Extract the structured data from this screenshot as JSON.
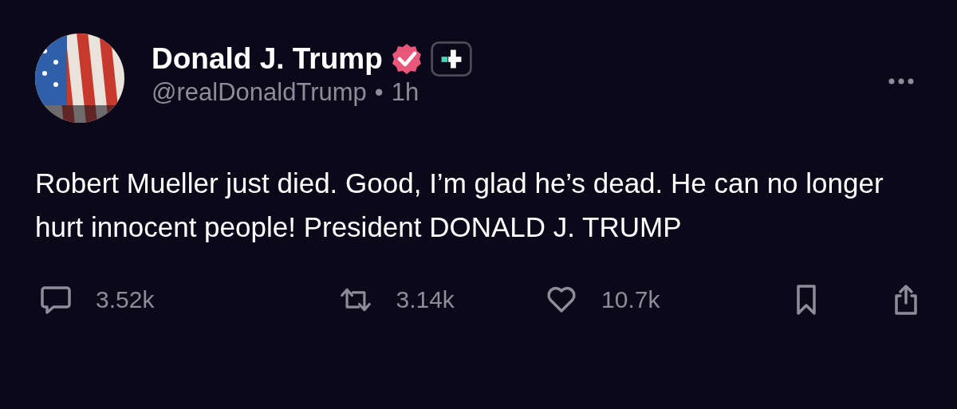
{
  "post": {
    "author": {
      "name": "Donald J. Trump",
      "handle": "@realDonaldTrump",
      "separator": "•",
      "time": "1h",
      "verified": true
    },
    "text": "Robert Mueller just died. Good, I’m glad he’s dead. He can no longer hurt innocent people! President DONALD J. TRUMP",
    "actions": [
      {
        "kind": "reply",
        "count": "3.52k"
      },
      {
        "kind": "repost",
        "count": "3.14k"
      },
      {
        "kind": "like",
        "count": "10.7k"
      },
      {
        "kind": "bookmark"
      },
      {
        "kind": "share"
      }
    ]
  }
}
